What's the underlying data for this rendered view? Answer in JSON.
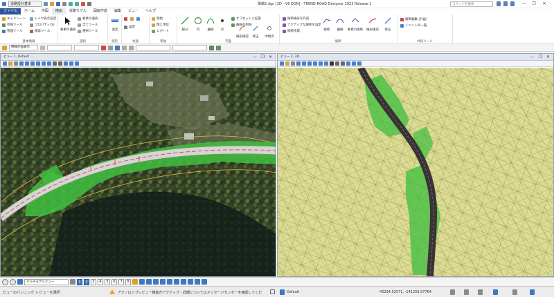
{
  "titlebar": {
    "workspace": "道路設計基本",
    "title": "陽嶋2.dgn [2D - V8 DGN] - TREND-ROAD Designer 2023 Release 1",
    "search_placeholder": "コマンドを検索",
    "minimize": "—",
    "restore": "❐",
    "close": "✕"
  },
  "menu": {
    "tabs": [
      "ファイル",
      "ホーム",
      "作図",
      "描画",
      "道路モデル",
      "図面作成",
      "編集",
      "ビュー",
      "ヘルプ"
    ]
  },
  "ribbon": {
    "groups": [
      {
        "label": "基本情報",
        "items": [
          "キャドシート",
          "レイヤ表示設定",
          "参照ツール",
          "プロパティ(S)",
          "管理ツール",
          "検索ツール"
        ]
      },
      {
        "label": "選択",
        "items": [
          "要素の選択",
          "要素の選択",
          "全てツール",
          "全てツール",
          "選択ツール"
        ]
      },
      {
        "label": "測定",
        "items": [
          "測定"
        ]
      },
      {
        "label": "共通",
        "items": [
          "設定"
        ]
      },
      {
        "label": "単独",
        "items": [
          "開始",
          "閉じ単位",
          "分ツール",
          "一般",
          "レポート"
        ]
      },
      {
        "label": "平面",
        "items": [
          "線分",
          "円",
          "曲線",
          "点",
          "オフセットと拡張",
          "曲線を削除",
          "線形確認",
          "修正",
          "中間点"
        ]
      },
      {
        "label": "縦断",
        "items": [
          "縦断線形を作成",
          "アクティブな縦断を設定",
          "縦断作成",
          "縦断",
          "曲線",
          "要素の縦断",
          "線形確認",
          "修正"
        ]
      },
      {
        "label": "共同ツール",
        "items": [
          "縦断編集 (計画)",
          "イベントの一覧"
        ]
      }
    ]
  },
  "attrbar": {
    "style_field": "幹線計画表示"
  },
  "views": {
    "left_title": "ビュー 1, Default",
    "right_title": "ビュー 2, 3D"
  },
  "bottombar": {
    "view_type": "マルチモデルビュー",
    "view_numbers": [
      "1",
      "2",
      "3",
      "4",
      "5",
      "6",
      "7",
      "8"
    ]
  },
  "status": {
    "left": "ビューのパンニング > ビューを選択",
    "message": "アクノロジプレビュー機能がアクティブ - 詳細についてはメッセージセンターを確認してくだ",
    "model": "Default",
    "coords": "43234.52571, -141259.97764"
  },
  "colors": {
    "file_tab": "#2b579a",
    "road_fill": "#3fbf3f",
    "terrain": "#d8da8e",
    "accent": "#3f78c2"
  }
}
